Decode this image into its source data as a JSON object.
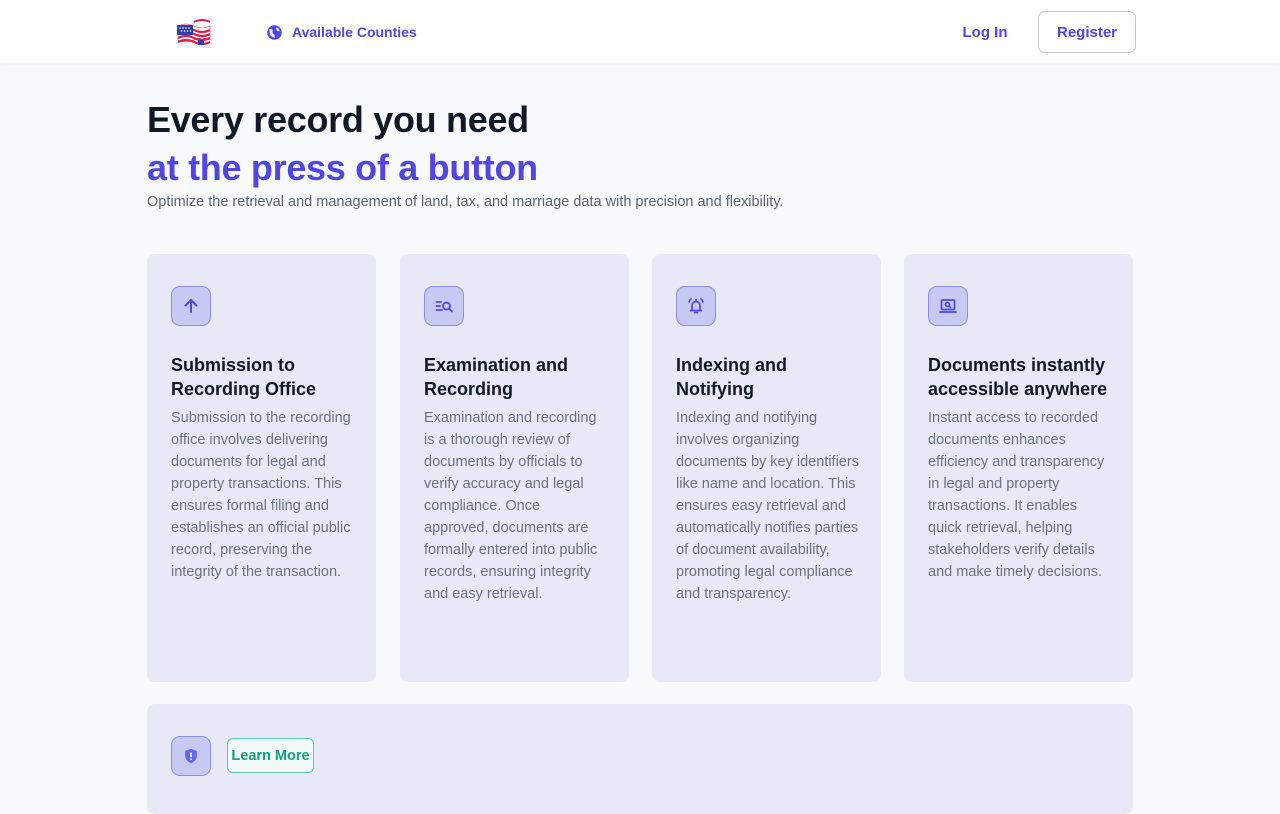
{
  "header": {
    "logo_icon": "us-flag-logo-icon",
    "nav_counties_label": "Available Counties",
    "nav_counties_icon": "globe-icon",
    "login_label": "Log In",
    "register_label": "Register"
  },
  "hero": {
    "title_line1": "Every record you need",
    "title_line2": "at the press of a button",
    "subtitle": "Optimize the retrieval and management of land, tax, and marriage data with precision and flexibility."
  },
  "cards": [
    {
      "icon": "arrow-up-icon",
      "title": "Submission to Recording Office",
      "text": "Submission to the recording office involves delivering documents for legal and property transactions. This ensures formal filing and establishes an official public record, preserving the integrity of the transaction."
    },
    {
      "icon": "document-search-icon",
      "title": "Examination and Recording",
      "text": "Examination and recording is a thorough review of documents by officials to verify accuracy and legal compliance. Once approved, documents are formally entered into public records, ensuring integrity and easy retrieval."
    },
    {
      "icon": "bell-alert-icon",
      "title": "Indexing and Notifying",
      "text": "Indexing and notifying involves organizing documents by key identifiers like name and location. This ensures easy retrieval and automatically notifies parties of document availability, promoting legal compliance and transparency."
    },
    {
      "icon": "laptop-search-icon",
      "title": "Documents instantly accessible anywhere",
      "text": "Instant access to recorded documents enhances efficiency and transparency in legal and property transactions. It enables quick retrieval, helping stakeholders verify details and make timely decisions."
    }
  ],
  "bottom": {
    "icon": "shield-icon",
    "learn_more_label": "Learn More"
  },
  "colors": {
    "accent": "#4f46e5",
    "card_bg": "#e8e9f7",
    "icon_bg": "#c7c9f3",
    "learn_more": "#10a37a"
  }
}
